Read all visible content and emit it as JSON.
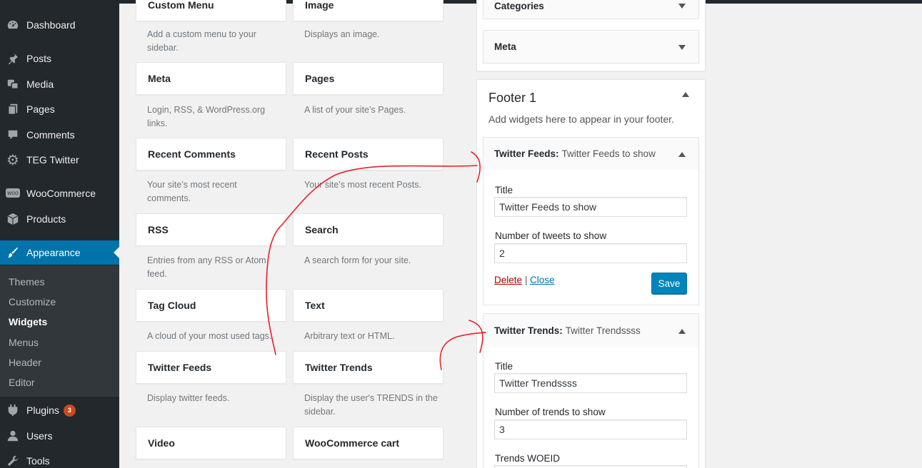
{
  "sidebar": {
    "items": [
      {
        "label": "Dashboard",
        "icon": "dashboard-icon"
      },
      {
        "label": "Posts",
        "icon": "pin-icon"
      },
      {
        "label": "Media",
        "icon": "media-icon"
      },
      {
        "label": "Pages",
        "icon": "pages-icon"
      },
      {
        "label": "Comments",
        "icon": "comment-icon"
      },
      {
        "label": "TEG Twitter",
        "icon": "gear-icon"
      },
      {
        "label": "WooCommerce",
        "icon": "woo-icon"
      },
      {
        "label": "Products",
        "icon": "box-icon"
      },
      {
        "label": "Appearance",
        "icon": "brush-icon"
      },
      {
        "label": "Plugins",
        "icon": "plug-icon",
        "badge": "3"
      },
      {
        "label": "Users",
        "icon": "user-icon"
      },
      {
        "label": "Tools",
        "icon": "wrench-icon"
      }
    ],
    "submenu": [
      "Themes",
      "Customize",
      "Widgets",
      "Menus",
      "Header",
      "Editor"
    ]
  },
  "available_widgets": [
    {
      "title": "Custom Menu",
      "desc": "Add a custom menu to your sidebar."
    },
    {
      "title": "Image",
      "desc": "Displays an image."
    },
    {
      "title": "Meta",
      "desc": "Login, RSS, & WordPress.org links."
    },
    {
      "title": "Pages",
      "desc": "A list of your site’s Pages."
    },
    {
      "title": "Recent Comments",
      "desc": "Your site’s most recent comments."
    },
    {
      "title": "Recent Posts",
      "desc": "Your site’s most recent Posts."
    },
    {
      "title": "RSS",
      "desc": "Entries from any RSS or Atom feed."
    },
    {
      "title": "Search",
      "desc": "A search form for your site."
    },
    {
      "title": "Tag Cloud",
      "desc": "A cloud of your most used tags."
    },
    {
      "title": "Text",
      "desc": "Arbitrary text or HTML."
    },
    {
      "title": "Twitter Feeds",
      "desc": "Display twitter feeds."
    },
    {
      "title": "Twitter Trends",
      "desc": "Display the user's TRENDS in the sidebar."
    },
    {
      "title": "Video",
      "desc": ""
    },
    {
      "title": "WooCommerce cart",
      "desc": ""
    }
  ],
  "sidebar_area": {
    "collapsed": [
      {
        "label": "Categories"
      },
      {
        "label": "Meta"
      }
    ]
  },
  "footer1": {
    "title": "Footer 1",
    "description": "Add widgets here to appear in your footer.",
    "twitter_feeds": {
      "type": "Twitter Feeds:",
      "name": "Twitter Feeds to show",
      "title_label": "Title",
      "title_value": "Twitter Feeds to show",
      "count_label": "Number of tweets to show",
      "count_value": "2",
      "delete": "Delete",
      "separator": "|",
      "close": "Close",
      "save": "Save"
    },
    "twitter_trends": {
      "type": "Twitter Trends:",
      "name": "Twitter Trendssss",
      "title_label": "Title",
      "title_value": "Twitter Trendssss",
      "count_label": "Number of trends to show",
      "count_value": "3",
      "woeid_label": "Trends WOEID"
    }
  },
  "colors": {
    "admin_bar": "#23282d",
    "menu_active": "#0073aa",
    "submenu_bg": "#32373c",
    "plugin_badge": "#ca4a1f",
    "primary_button": "#0085ba",
    "delete_link": "#a00",
    "link": "#0073aa",
    "annotation_red": "#e8202a"
  }
}
